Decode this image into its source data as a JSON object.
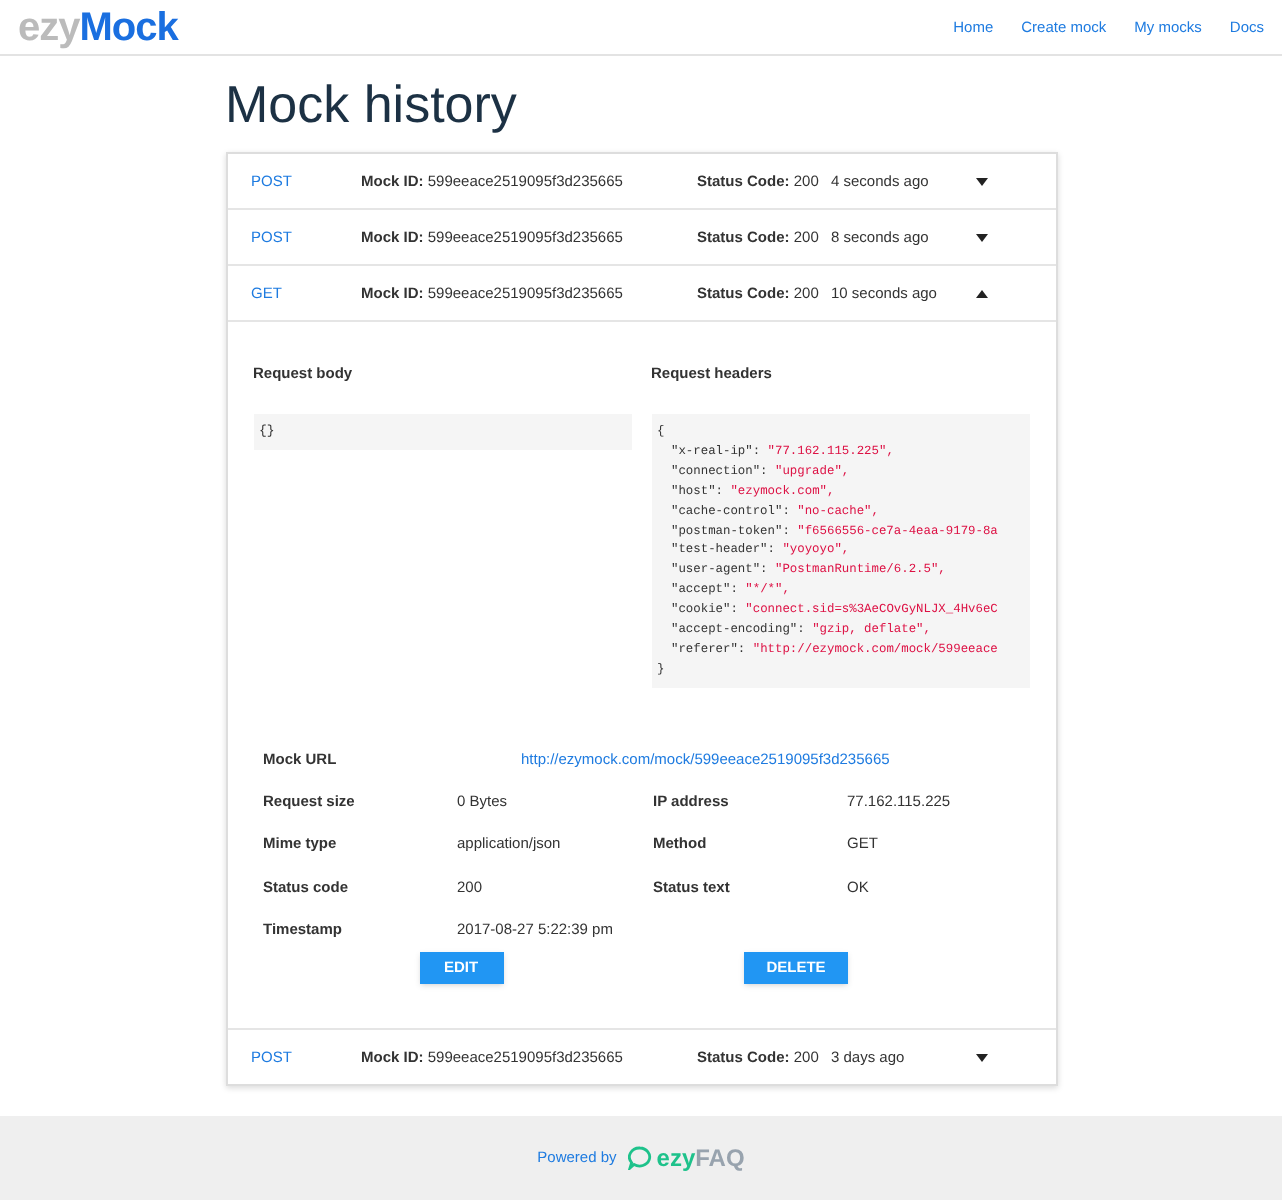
{
  "logo": {
    "part_1": "ezy",
    "part_2": "Mock"
  },
  "nav": [
    "Home",
    "Create mock",
    "My mocks",
    "Docs"
  ],
  "title": "Mock history",
  "mocks": [
    {
      "method": "POST",
      "mock_id": "**Mock ID:** 599eeace2519095f3d235665",
      "status": "**Status Code:** 200",
      "time": "4 seconds ago",
      "expanded": false
    },
    {
      "method": "POST",
      "mock_id": "**Mock ID:** 599eeace2519095f3d235665",
      "status": "**Status Code:** 200",
      "time": "8 seconds ago",
      "expanded": false
    },
    {
      "method": "GET",
      "mock_id": "**Mock ID:** 599eeace2519095f3d235665",
      "status": "**Status Code:** 200",
      "time": "10 seconds ago",
      "expanded": true,
      "details": {
        "body_title": "Request body",
        "body": "{}",
        "headers_title": "Request headers",
        "headers_open": "{",
        "headers": [
          {
            "key": "\"x-real-ip\": ",
            "value": "\"77.162.115.225\","
          },
          {
            "key": "\"connection\": ",
            "value": "\"upgrade\","
          },
          {
            "key": "\"host\": ",
            "value": "\"ezymock.com\","
          },
          {
            "key": "\"cache-control\": ",
            "value": "\"no-cache\","
          },
          {
            "key": "\"postman-token\": ",
            "value": "\"f6566556-ce7a-4eaa-9179-8a"
          },
          {
            "key": "\"test-header\": ",
            "value": "\"yoyoyo\","
          },
          {
            "key": "\"user-agent\": ",
            "value": "\"PostmanRuntime/6.2.5\","
          },
          {
            "key": "\"accept\": ",
            "value": "\"*/*\","
          },
          {
            "key": "\"cookie\": ",
            "value": "\"connect.sid=s%3AeCOvGyNLJX_4Hv6eC"
          },
          {
            "key": "\"accept-encoding\": ",
            "value": "\"gzip, deflate\","
          },
          {
            "key": "\"referer\": ",
            "value": "\"http://ezymock.com/mock/599eeace"
          }
        ],
        "headers_close": "}",
        "url_label": "Mock URL",
        "url": "http://ezymock.com/mock/599eeace2519095f3d235665",
        "fields": [
          {
            "label": "Request size",
            "value": "0 Bytes",
            "label_2": "IP address",
            "value_2": "77.162.115.225"
          },
          {
            "label": "Mime type",
            "value": "application/json",
            "label_2": "Method",
            "value_2": "GET"
          },
          {
            "label": "Status code",
            "value": "200",
            "label_2": "Status text",
            "value_2": "OK"
          },
          {
            "label": "Timestamp",
            "value": "2017-08-27 5:22:39 pm"
          }
        ],
        "buttons": [
          "EDIT",
          "DELETE"
        ]
      }
    },
    {
      "method": "POST",
      "mock_id": "**Mock ID:** 599eeace2519095f3d235665",
      "status": "**Status Code:** 200",
      "time": "3 days ago",
      "expanded": false
    }
  ],
  "footer": {
    "text": "Powered by",
    "brand_1": "ezy",
    "brand_2": "FAQ"
  }
}
